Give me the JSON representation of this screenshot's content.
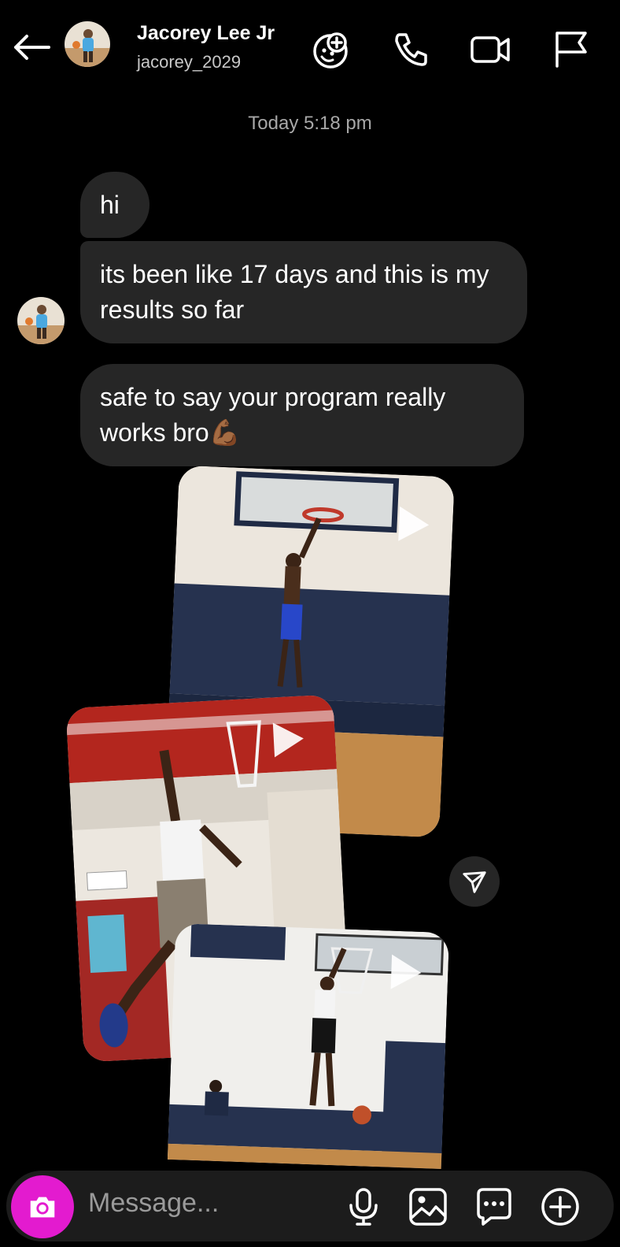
{
  "header": {
    "name": "Jacorey Lee Jr",
    "username": "jacorey_2029",
    "icons": [
      "back-arrow-icon",
      "add-people-icon",
      "phone-icon",
      "video-icon",
      "flag-icon"
    ]
  },
  "thread": {
    "timestamp": "Today 5:18 pm",
    "messages": [
      {
        "text": "hi"
      },
      {
        "text": "its been like 17 days and this is my results so far"
      },
      {
        "text": "safe to say your program really works bro💪🏾"
      }
    ],
    "media": [
      {
        "type": "video",
        "desc": "dunk-clip-1"
      },
      {
        "type": "video",
        "desc": "dunk-clip-2"
      },
      {
        "type": "video",
        "desc": "dunk-clip-3"
      }
    ]
  },
  "composer": {
    "placeholder": "Message...",
    "icons": [
      "camera-icon",
      "microphone-icon",
      "gallery-icon",
      "sticker-icon",
      "plus-icon"
    ]
  },
  "colors": {
    "background": "#000000",
    "bubble": "#262626",
    "camera_button": "#e31bcf"
  }
}
